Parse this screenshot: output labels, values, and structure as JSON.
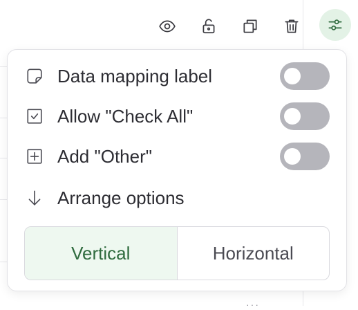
{
  "toolbar": {
    "buttons": [
      {
        "icon": "eye-icon"
      },
      {
        "icon": "lock-open-icon"
      },
      {
        "icon": "duplicate-icon"
      },
      {
        "icon": "trash-icon"
      },
      {
        "icon": "settings-sliders-icon",
        "active": true
      }
    ]
  },
  "popover": {
    "rows": [
      {
        "icon": "sticky-note-icon",
        "label": "Data mapping label",
        "toggle_on": false
      },
      {
        "icon": "checkbox-icon",
        "label": "Allow \"Check All\"",
        "toggle_on": false
      },
      {
        "icon": "plus-square-icon",
        "label": "Add \"Other\"",
        "toggle_on": false
      }
    ],
    "arrange": {
      "icon": "arrow-down-icon",
      "label": "Arrange options",
      "options": [
        "Vertical",
        "Horizontal"
      ],
      "selected": "Vertical"
    }
  },
  "colors": {
    "accent": "#2f6b3e",
    "accent_bg": "#eef8f0",
    "toggle_off": "#b5b5bb"
  }
}
